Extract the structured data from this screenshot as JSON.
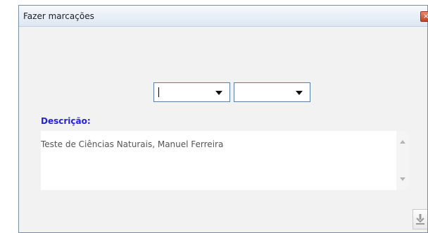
{
  "window": {
    "title": "Fazer marcações",
    "close_icon": "close-icon",
    "close_glyph": "×"
  },
  "form": {
    "combo_1": {
      "value": "",
      "icon": "chevron-down-icon"
    },
    "combo_2": {
      "value": "",
      "icon": "chevron-down-icon"
    },
    "description_label": "Descrição:",
    "description_value": "Teste de Ciências Naturais, Manuel Ferreira",
    "save_icon": "download-icon"
  },
  "colors": {
    "label_accent": "#2323d8",
    "window_border": "#7a8fa6",
    "close_button": "#c0432a"
  }
}
